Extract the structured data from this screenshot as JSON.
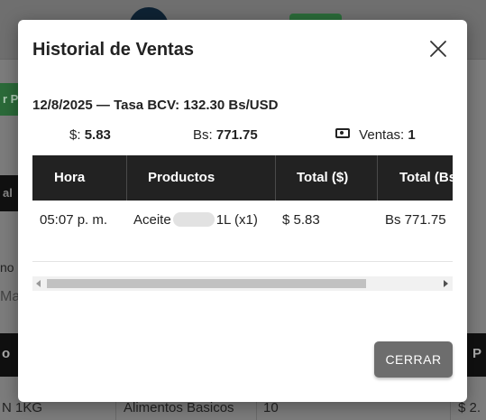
{
  "background": {
    "left_green_label": "r P",
    "left_dark_label": "al",
    "left_text_1": "no",
    "left_text_2": "Ma",
    "header_left": "o",
    "header_right": "P",
    "row": {
      "col1": "N 1KG",
      "col2": "Alimentos Basicos",
      "col3": "10",
      "col4": "$ 2."
    }
  },
  "modal": {
    "title": "Historial de Ventas",
    "close_icon": "close-icon",
    "info": {
      "date": "12/8/2025",
      "separator": "—",
      "rate_label": "Tasa BCV:",
      "rate_value": "132.30 Bs/USD"
    },
    "stats": {
      "usd_label": "$:",
      "usd_value": "5.83",
      "bs_label": "Bs:",
      "bs_value": "771.75",
      "sales_icon": "money-icon",
      "sales_label": "Ventas:",
      "sales_value": "1"
    },
    "table": {
      "headers": [
        "Hora",
        "Productos",
        "Total ($)",
        "Total (Bs"
      ],
      "rows": [
        {
          "hora": "05:07 p. m.",
          "producto_prefix": "Aceite",
          "producto_suffix": "1L (x1)",
          "total_usd": "$ 5.83",
          "total_bs": "Bs 771.75"
        }
      ]
    },
    "close_button_label": "CERRAR"
  },
  "colors": {
    "overlay": "#7c7c7c",
    "table_header": "#222222",
    "button": "#6d6d6d",
    "brand_green": "#2a6b39"
  }
}
